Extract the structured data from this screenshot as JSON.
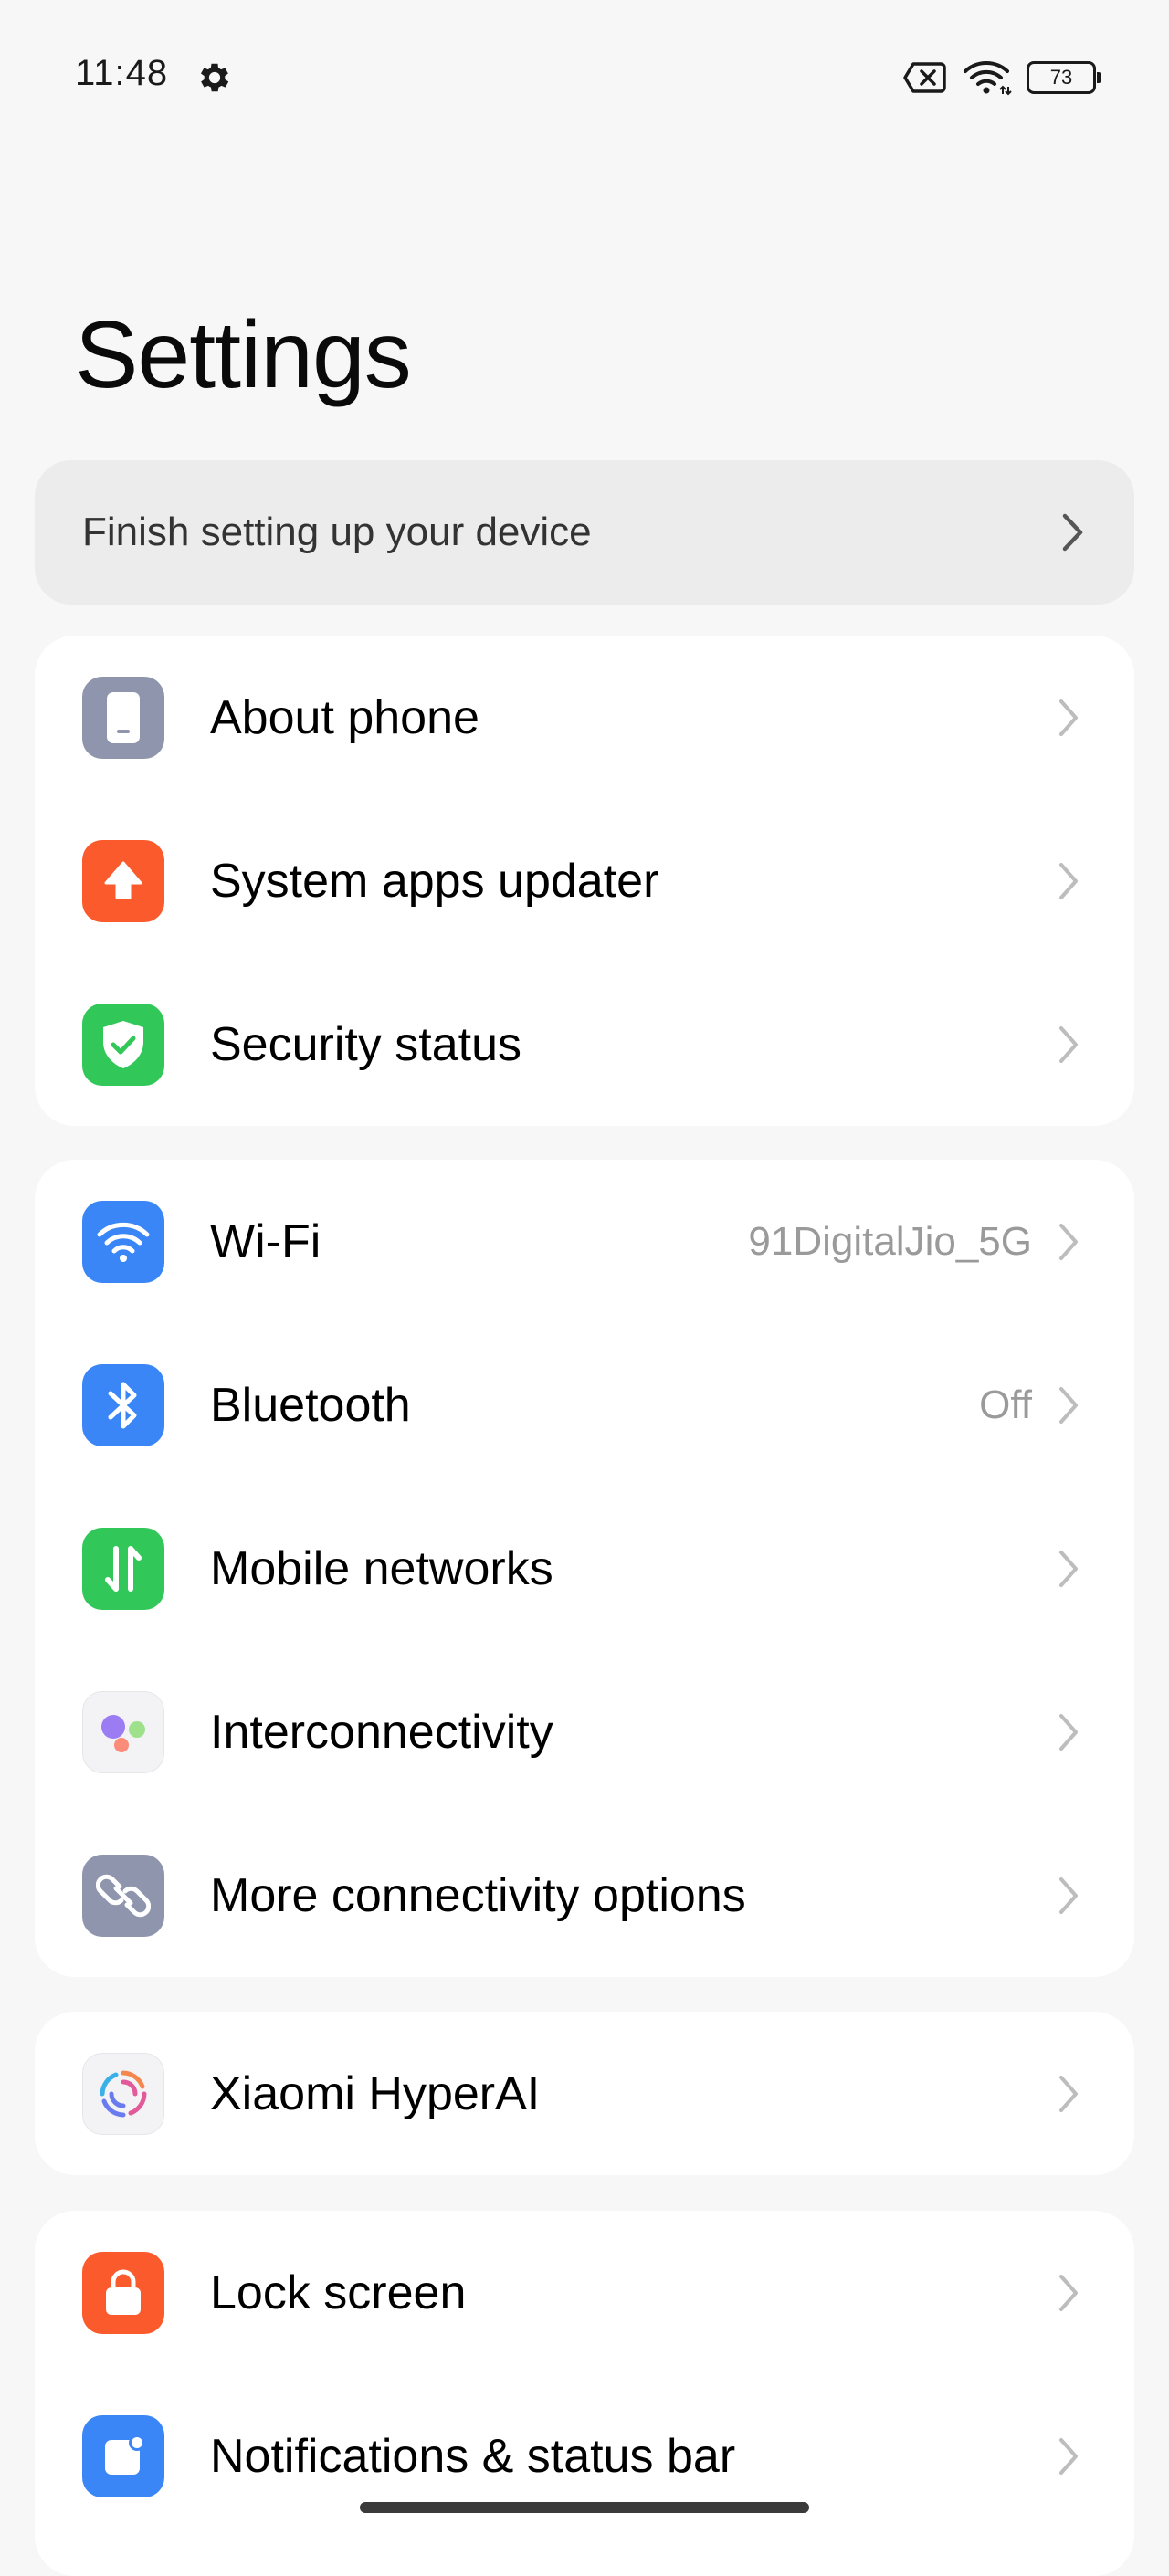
{
  "status_bar": {
    "time": "11:48",
    "battery": "73",
    "icons": [
      "gear-icon",
      "no-sim-icon",
      "wifi-icon",
      "battery-icon"
    ]
  },
  "page": {
    "title": "Settings"
  },
  "setup_banner": {
    "label": "Finish setting up your device"
  },
  "groups": [
    {
      "items": [
        {
          "label": "About phone",
          "icon": "phone-icon",
          "color": "#8e95ad",
          "value": ""
        },
        {
          "label": "System apps updater",
          "icon": "arrow-up-icon",
          "color": "#fb5a2d",
          "value": ""
        },
        {
          "label": "Security status",
          "icon": "shield-check-icon",
          "color": "#32c759",
          "value": ""
        }
      ]
    },
    {
      "items": [
        {
          "label": "Wi-Fi",
          "icon": "wifi-icon",
          "color": "#3a86f7",
          "value": "91DigitalJio_5G"
        },
        {
          "label": "Bluetooth",
          "icon": "bluetooth-icon",
          "color": "#3a86f7",
          "value": "Off"
        },
        {
          "label": "Mobile networks",
          "icon": "mobile-data-icon",
          "color": "#32c759",
          "value": ""
        },
        {
          "label": "Interconnectivity",
          "icon": "interconnectivity-icon",
          "color": "#f3f3f5",
          "value": ""
        },
        {
          "label": "More connectivity options",
          "icon": "link-icon",
          "color": "#8e95ad",
          "value": ""
        }
      ]
    },
    {
      "items": [
        {
          "label": "Xiaomi HyperAI",
          "icon": "hyperai-icon",
          "color": "#f3f3f5",
          "value": ""
        }
      ]
    },
    {
      "items": [
        {
          "label": "Lock screen",
          "icon": "lock-icon",
          "color": "#fb5a2d",
          "value": ""
        },
        {
          "label": "Notifications & status bar",
          "icon": "notification-icon",
          "color": "#3a86f7",
          "value": ""
        }
      ]
    }
  ]
}
